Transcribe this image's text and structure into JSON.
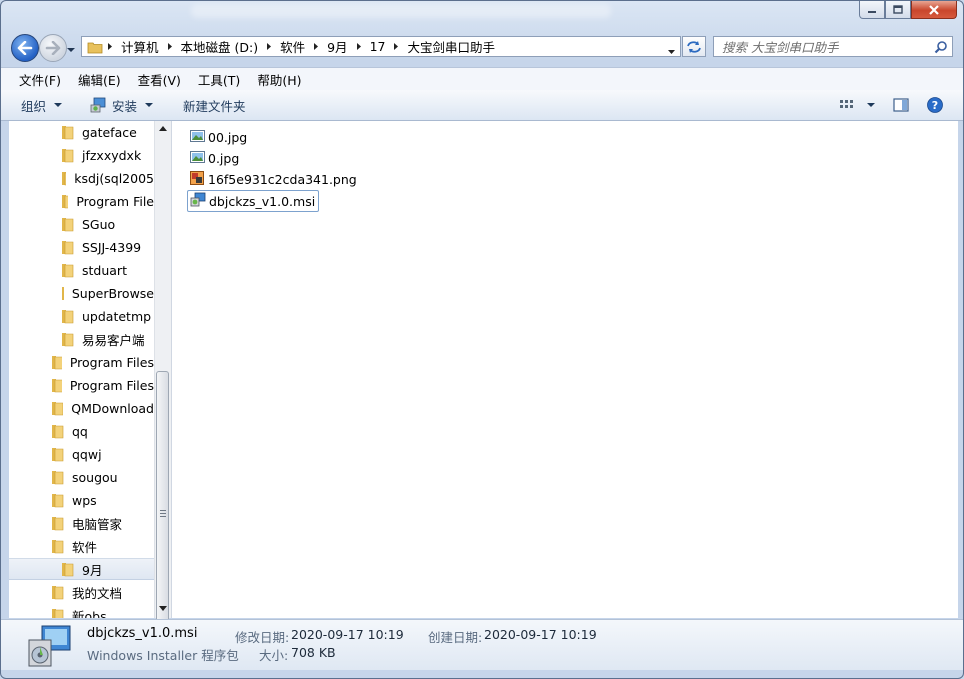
{
  "window": {
    "caption_buttons": [
      "minimize",
      "maximize",
      "close"
    ],
    "colors": {
      "accent": "#2461c5",
      "selection_border": "#7da2ce",
      "close": "#c9462c"
    }
  },
  "address_bar": {
    "segments": [
      "计算机",
      "本地磁盘 (D:)",
      "软件",
      "9月",
      "17",
      "大宝剑串口助手"
    ]
  },
  "search": {
    "placeholder": "搜索 大宝剑串口助手"
  },
  "menu": {
    "items": [
      "文件(F)",
      "编辑(E)",
      "查看(V)",
      "工具(T)",
      "帮助(H)"
    ]
  },
  "toolbar": {
    "organize": "组织",
    "install": "安装",
    "new_folder": "新建文件夹"
  },
  "nav_pane": {
    "items": [
      {
        "label": "gateface",
        "level": 2
      },
      {
        "label": "jfzxxydxk",
        "level": 2
      },
      {
        "label": "ksdj(sql2005",
        "level": 2
      },
      {
        "label": "Program File",
        "level": 2
      },
      {
        "label": "SGuo",
        "level": 2
      },
      {
        "label": "SSJJ-4399",
        "level": 2
      },
      {
        "label": "stduart",
        "level": 2
      },
      {
        "label": "SuperBrowse",
        "level": 2
      },
      {
        "label": "updatetmp",
        "level": 2
      },
      {
        "label": "易易客户端",
        "level": 2
      },
      {
        "label": "Program Files",
        "level": 1
      },
      {
        "label": "Program Files",
        "level": 1
      },
      {
        "label": "QMDownload",
        "level": 1
      },
      {
        "label": "qq",
        "level": 1
      },
      {
        "label": "qqwj",
        "level": 1
      },
      {
        "label": "sougou",
        "level": 1
      },
      {
        "label": "wps",
        "level": 1
      },
      {
        "label": "电脑管家",
        "level": 1
      },
      {
        "label": "软件",
        "level": 1
      },
      {
        "label": "9月",
        "level": 2,
        "selected": true
      },
      {
        "label": "我的文档",
        "level": 1
      },
      {
        "label": "新obs",
        "level": 1
      }
    ]
  },
  "files": [
    {
      "name": "00.jpg",
      "icon": "image-file-icon"
    },
    {
      "name": "0.jpg",
      "icon": "image-file-icon"
    },
    {
      "name": "16f5e931c2cda341.png",
      "icon": "png-file-icon"
    },
    {
      "name": "dbjckzs_v1.0.msi",
      "icon": "msi-file-icon",
      "focused": true
    }
  ],
  "details": {
    "name": "dbjckzs_v1.0.msi",
    "type": "Windows Installer 程序包",
    "modified_label": "修改日期:",
    "modified_value": "2020-09-17 10:19",
    "size_label": "大小:",
    "size_value": "708 KB",
    "created_label": "创建日期:",
    "created_value": "2020-09-17 10:19"
  }
}
